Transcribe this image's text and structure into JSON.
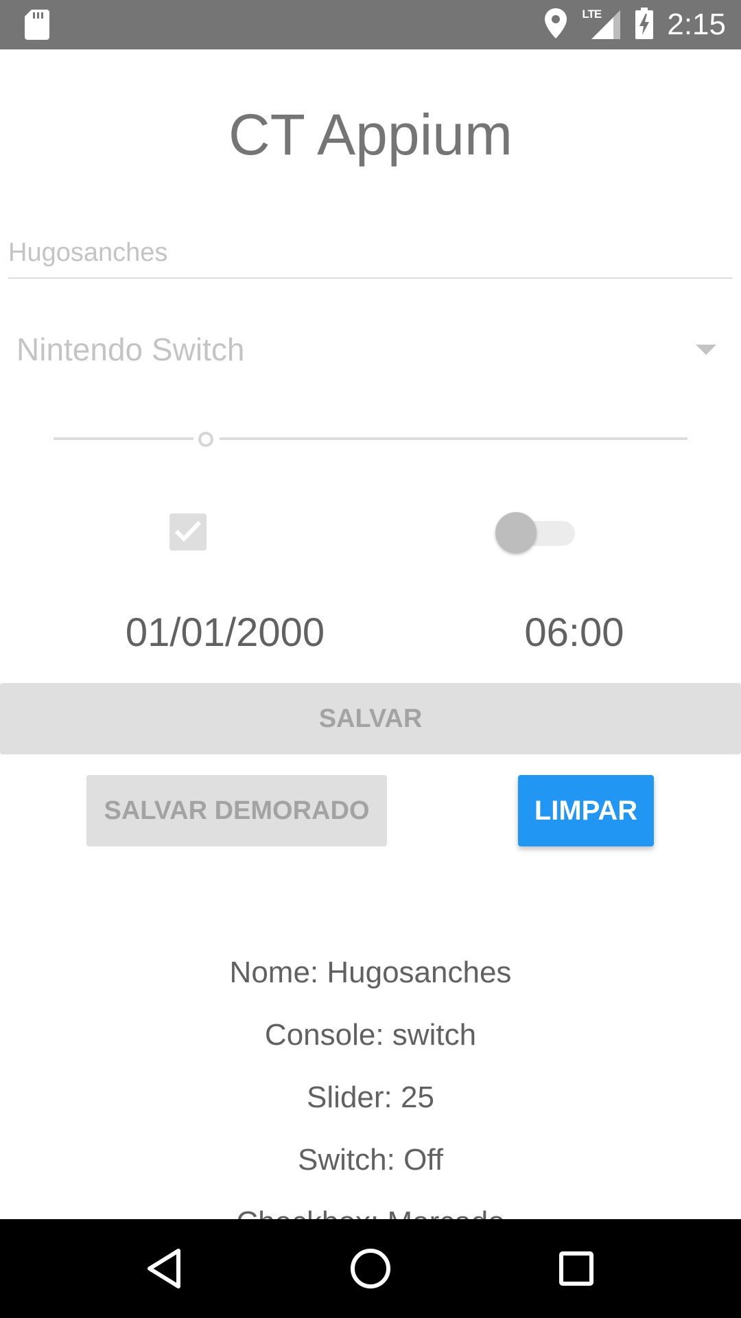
{
  "status_bar": {
    "time": "2:15",
    "network": "LTE",
    "icons": [
      "sd-card-icon",
      "location-icon",
      "lte-signal-icon",
      "battery-charging-icon"
    ]
  },
  "app": {
    "title": "CT Appium"
  },
  "form": {
    "name_placeholder": "Hugosanches",
    "name_value": "",
    "console_selected": "Nintendo Switch",
    "slider_value": 25,
    "checkbox_checked": true,
    "switch_on": false,
    "date": "01/01/2000",
    "time": "06:00"
  },
  "buttons": {
    "save": "SALVAR",
    "save_delayed": "SALVAR DEMORADO",
    "clear": "LIMPAR"
  },
  "results": [
    "Nome: Hugosanches",
    "Console: switch",
    "Slider: 25",
    "Switch: Off",
    "Checkbox: Marcado"
  ],
  "nav_bar": [
    "back-icon",
    "home-icon",
    "recents-icon"
  ],
  "colors": {
    "status_bar": "#757575",
    "accent": "#2196f3",
    "disabled_button": "#dfdfdf",
    "nav_bar": "#000000"
  }
}
